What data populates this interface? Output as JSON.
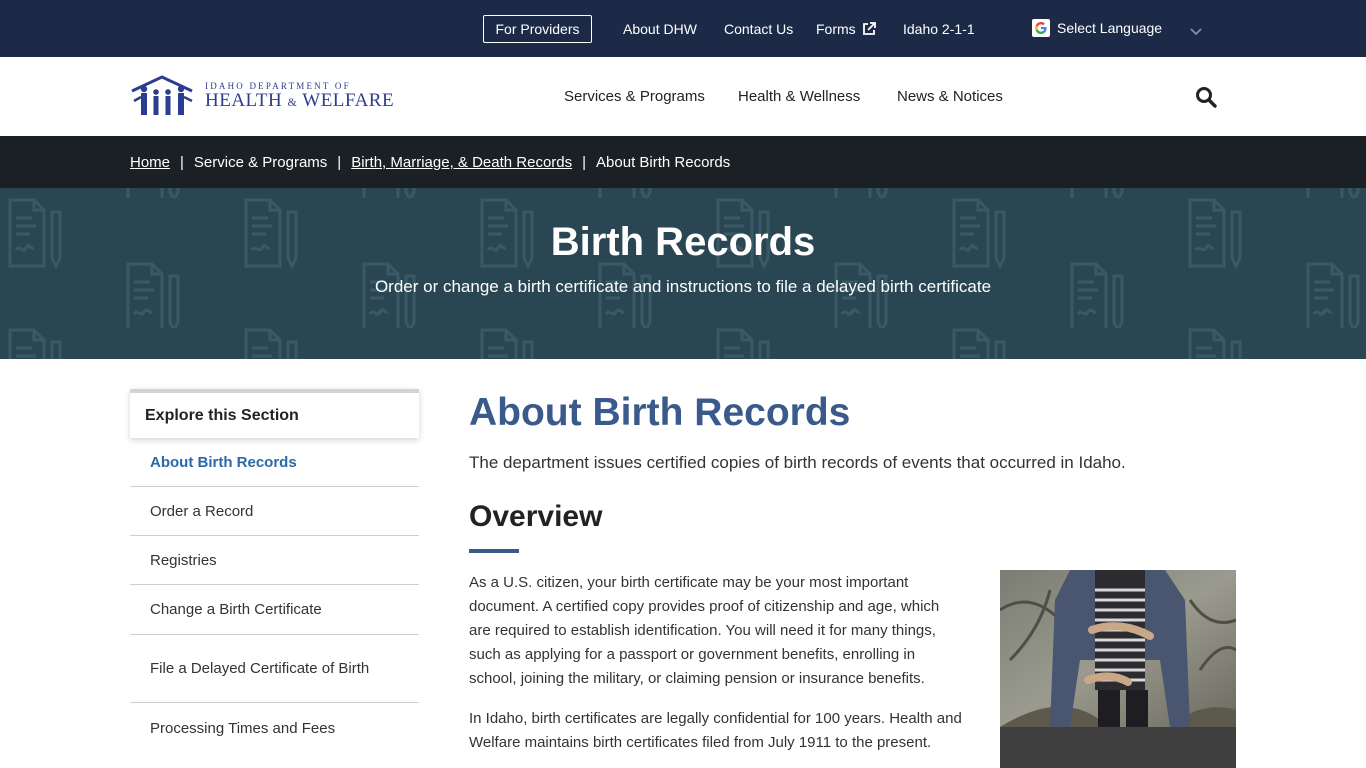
{
  "utility": {
    "providers": "For Providers",
    "about": "About DHW",
    "contact": "Contact Us",
    "forms": "Forms",
    "idaho211": "Idaho 2-1-1",
    "language": "Select Language"
  },
  "logo": {
    "top": "IDAHO DEPARTMENT OF",
    "main_left": "HEALTH",
    "amp": "&",
    "main_right": "WELFARE"
  },
  "nav": {
    "services": "Services & Programs",
    "health": "Health & Wellness",
    "news": "News & Notices"
  },
  "breadcrumb": {
    "home": "Home",
    "sep": "|",
    "services": "Service & Programs",
    "records": "Birth, Marriage, & Death Records",
    "current": "About Birth Records"
  },
  "hero": {
    "title": "Birth Records",
    "subtitle": "Order or change a birth certificate and instructions to file a delayed birth certificate"
  },
  "sidebar": {
    "heading": "Explore this Section",
    "items": [
      "About Birth Records",
      "Order a Record",
      "Registries",
      "Change a Birth Certificate",
      "File a Delayed Certificate of Birth",
      "Processing Times and Fees"
    ]
  },
  "main": {
    "title": "About Birth Records",
    "intro": "The department issues certified copies of birth records of events that occurred in Idaho.",
    "section_title": "Overview",
    "p1": "As a U.S. citizen, your birth certificate may be your most important document. A certified copy provides proof of citizenship and age, which are required to establish identification. You will need it for many things, such as applying for a passport or government benefits, enrolling in school, joining the military, or claiming pension or insurance benefits.",
    "p2": "In Idaho, birth certificates are legally confidential for 100 years. Health and Welfare maintains birth certificates filed from July 1911 to the present."
  },
  "colors": {
    "utility_bg": "#1c2a48",
    "breadcrumb_bg": "#1b2024",
    "hero_bg": "#2a4652",
    "accent": "#3a5a8c",
    "active_link": "#2a6aa8"
  },
  "icons": [
    "external-link-icon",
    "google-icon",
    "chevron-down-icon",
    "search-icon",
    "document-pattern-icon"
  ]
}
